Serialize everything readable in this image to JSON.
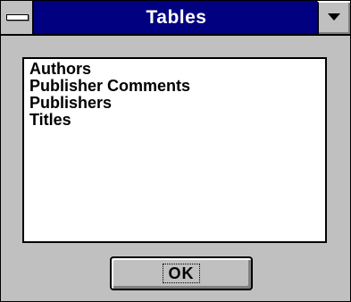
{
  "window": {
    "title": "Tables"
  },
  "titlebar": {
    "system_menu_icon": "system-menu-icon",
    "dropdown_icon": "chevron-down-icon"
  },
  "tables_list": {
    "items": [
      "Authors",
      "Publisher Comments",
      "Publishers",
      "Titles"
    ]
  },
  "buttons": {
    "ok_label": "OK"
  },
  "colors": {
    "titlebar": "#000080",
    "face": "#c0c0c0",
    "list_background": "#ffffff"
  }
}
